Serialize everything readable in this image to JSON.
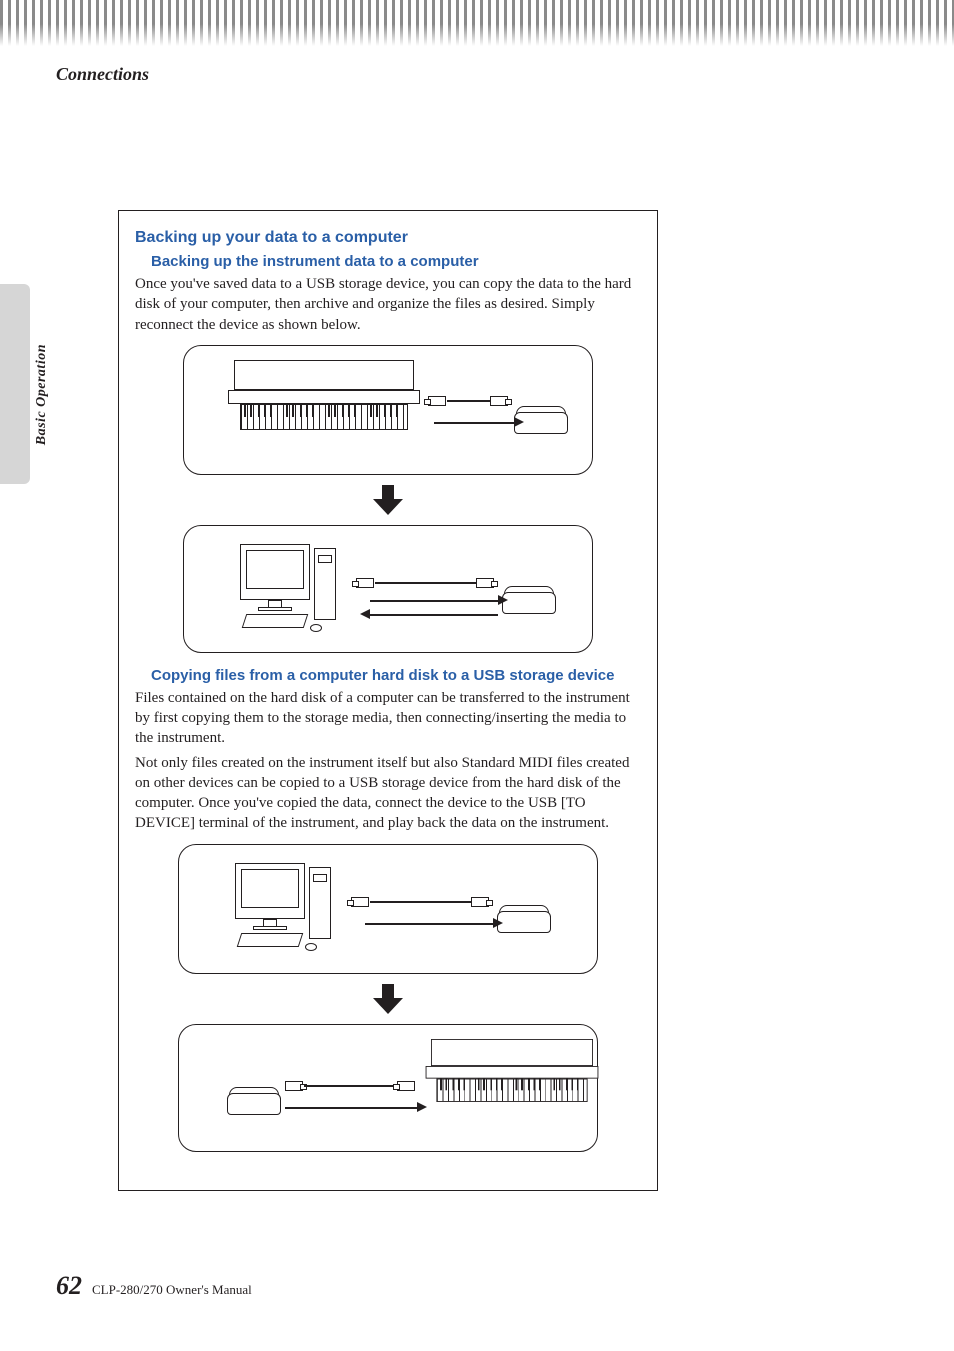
{
  "header": {
    "section_title": "Connections"
  },
  "sidebar": {
    "tab_label": "Basic Operation"
  },
  "content": {
    "h1": "Backing up your data to a computer",
    "section_a": {
      "heading": "Backing up the instrument data to a computer",
      "body": "Once you've saved data to a USB storage device, you can copy the data to the hard disk of your computer, then archive and organize the files as desired. Simply reconnect the device as shown below."
    },
    "section_b": {
      "heading": "Copying files from a computer hard disk to a USB storage device",
      "body1": "Files contained on the hard disk of a computer can be transferred to the instrument by first copying them to the storage media, then connecting/inserting the media to the instrument.",
      "body2": "Not only files created on the instrument itself but also Standard MIDI files created on other devices can be copied to a USB storage device from the hard disk of the computer. Once you've copied the data, connect the device to the USB [TO DEVICE] terminal of the instrument, and play back the data on the instrument."
    }
  },
  "footer": {
    "page_number": "62",
    "manual_title": "CLP-280/270 Owner's Manual"
  }
}
